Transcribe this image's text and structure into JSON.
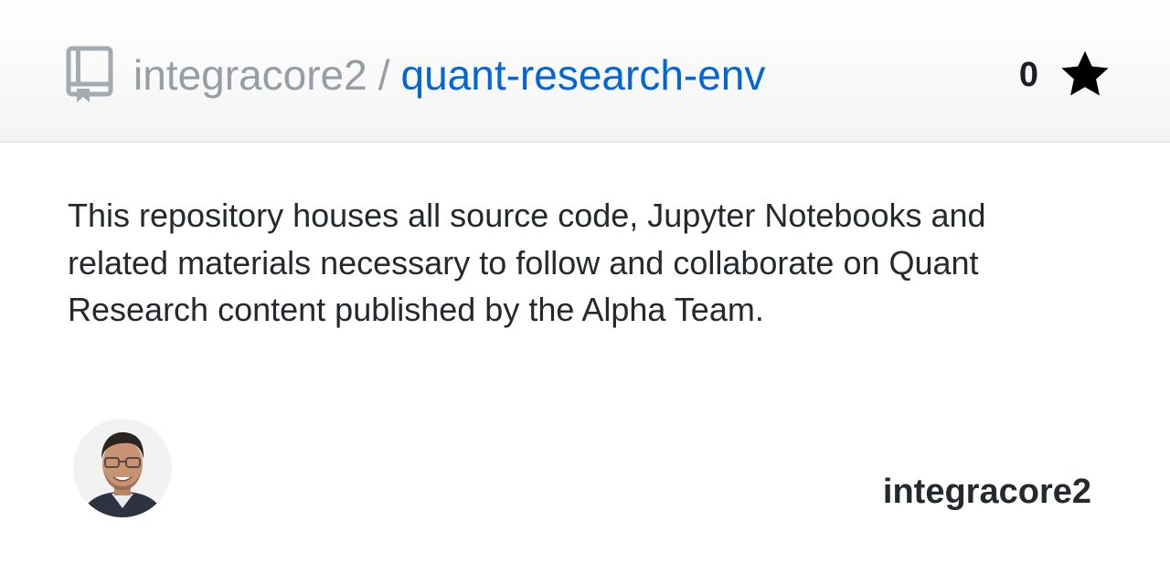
{
  "header": {
    "owner": "integracore2",
    "separator": "/",
    "repo_name": "quant-research-env",
    "star_count": "0",
    "icons": {
      "repo": "repo-icon",
      "star": "star-icon"
    }
  },
  "description": "This repository houses all source code, Jupyter Notebooks and related materials necessary to follow and collaborate on Quant Research content published by the Alpha Team.",
  "footer": {
    "owner_name": "integracore2"
  },
  "colors": {
    "link": "#0366d6",
    "muted": "#959da5",
    "text": "#24292e"
  }
}
